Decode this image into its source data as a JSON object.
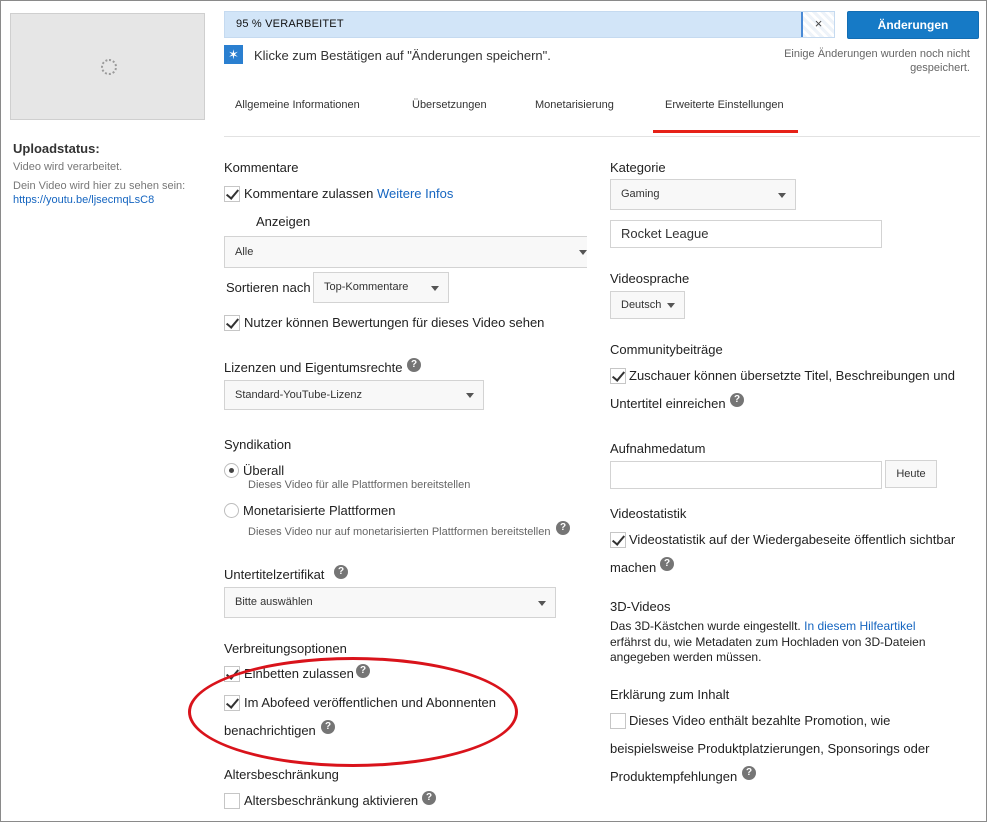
{
  "upload": {
    "title": "Uploadstatus:",
    "status": "Video wird verarbeitet.",
    "available_text": "Dein Video wird hier zu sehen sein:",
    "url": "https://youtu.be/ljsecmqLsC8"
  },
  "topbar": {
    "progress_text": "95 % VERARBEITET",
    "cancel_symbol": "×",
    "save_label": "Änderungen speichern",
    "info_text": "Klicke zum Bestätigen auf \"Änderungen speichern\".",
    "unsaved_line1": "Einige Änderungen wurden noch nicht",
    "unsaved_line2": "gespeichert.",
    "progress_percent": 95,
    "accent_color": "#167ac6"
  },
  "tabs": [
    {
      "label": "Allgemeine Informationen"
    },
    {
      "label": "Übersetzungen"
    },
    {
      "label": "Monetarisierung"
    },
    {
      "label": "Erweiterte Einstellungen",
      "active": true
    }
  ],
  "left": {
    "comments": {
      "heading": "Kommentare",
      "allow_label": "Kommentare zulassen",
      "more_info": "Weitere Infos",
      "show_label": "Anzeigen",
      "show_value": "Alle",
      "sort_label": "Sortieren nach",
      "sort_value": "Top-Kommentare",
      "ratings_label": "Nutzer können Bewertungen für dieses Video sehen"
    },
    "license": {
      "heading": "Lizenzen und Eigentumsrechte",
      "value": "Standard-YouTube-Lizenz"
    },
    "syndication": {
      "heading": "Syndikation",
      "opt1_label": "Überall",
      "opt1_desc": "Dieses Video für alle Plattformen bereitstellen",
      "opt2_label": "Monetarisierte Plattformen",
      "opt2_desc": "Dieses Video nur auf monetarisierten Plattformen bereitstellen"
    },
    "caption_cert": {
      "heading": "Untertitelzertifikat",
      "value": "Bitte auswählen"
    },
    "distribution": {
      "heading": "Verbreitungsoptionen",
      "embed_label": "Einbetten zulassen",
      "subfeed_line1": "Im Abofeed veröffentlichen und Abonnenten",
      "subfeed_line2": "benachrichtigen"
    },
    "age": {
      "heading": "Altersbeschränkung",
      "label": "Altersbeschränkung aktivieren"
    }
  },
  "right": {
    "category": {
      "heading": "Kategorie",
      "value": "Gaming",
      "game": "Rocket League"
    },
    "language": {
      "heading": "Videosprache",
      "value": "Deutsch"
    },
    "community": {
      "heading": "Communitybeiträge",
      "line1": "Zuschauer können übersetzte Titel, Beschreibungen und",
      "line2": "Untertitel einreichen"
    },
    "recording": {
      "heading": "Aufnahmedatum",
      "date_value": "",
      "today_label": "Heute"
    },
    "stats": {
      "heading": "Videostatistik",
      "line1": "Videostatistik auf der Wiedergabeseite öffentlich sichtbar",
      "line2": "machen"
    },
    "video3d": {
      "heading": "3D-Videos",
      "line1_a": "Das 3D-Kästchen wurde eingestellt.",
      "line1_link": "In diesem Hilfeartikel",
      "line2": "erfährst du, wie Metadaten zum Hochladen von 3D-Dateien",
      "line3": "angegeben werden müssen."
    },
    "content_decl": {
      "heading": "Erklärung zum Inhalt",
      "line1": "Dieses Video enthält bezahlte Promotion, wie",
      "line2": "beispielsweise Produktplatzierungen, Sponsorings oder",
      "line3": "Produktempfehlungen"
    }
  },
  "help_symbol": "?",
  "info_symbol": "✶"
}
